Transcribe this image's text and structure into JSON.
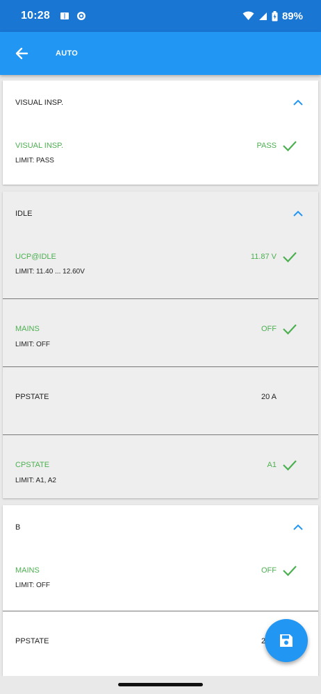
{
  "status_bar": {
    "time": "10:28",
    "battery": "89%"
  },
  "app_bar": {
    "title": "AUTO"
  },
  "sections": [
    {
      "title": "VISUAL INSP.",
      "rows": [
        {
          "name": "VISUAL INSP.",
          "limit": "LIMIT: PASS",
          "value": "PASS"
        }
      ]
    },
    {
      "title": "IDLE",
      "rows": [
        {
          "name": "UCP@IDLE",
          "limit": "LIMIT: 11.40 ... 12.60V",
          "value": "11.87 V"
        },
        {
          "name": "MAINS",
          "limit": "LIMIT: OFF",
          "value": "OFF"
        },
        {
          "name": "PPSTATE",
          "limit": "",
          "value": "20 A"
        },
        {
          "name": "CPSTATE",
          "limit": "LIMIT: A1, A2",
          "value": "A1"
        }
      ]
    },
    {
      "title": "B",
      "rows": [
        {
          "name": "MAINS",
          "limit": "LIMIT: OFF",
          "value": "OFF"
        },
        {
          "name": "PPSTATE",
          "limit": "",
          "value": "20 A"
        }
      ]
    }
  ],
  "colors": {
    "status_bar": "#1976d2",
    "app_bar": "#2196f3",
    "pass": "#4caf50",
    "accent": "#2196f3"
  },
  "icons": [
    "back-arrow-icon",
    "chevron-up-icon",
    "check-icon",
    "save-icon"
  ]
}
